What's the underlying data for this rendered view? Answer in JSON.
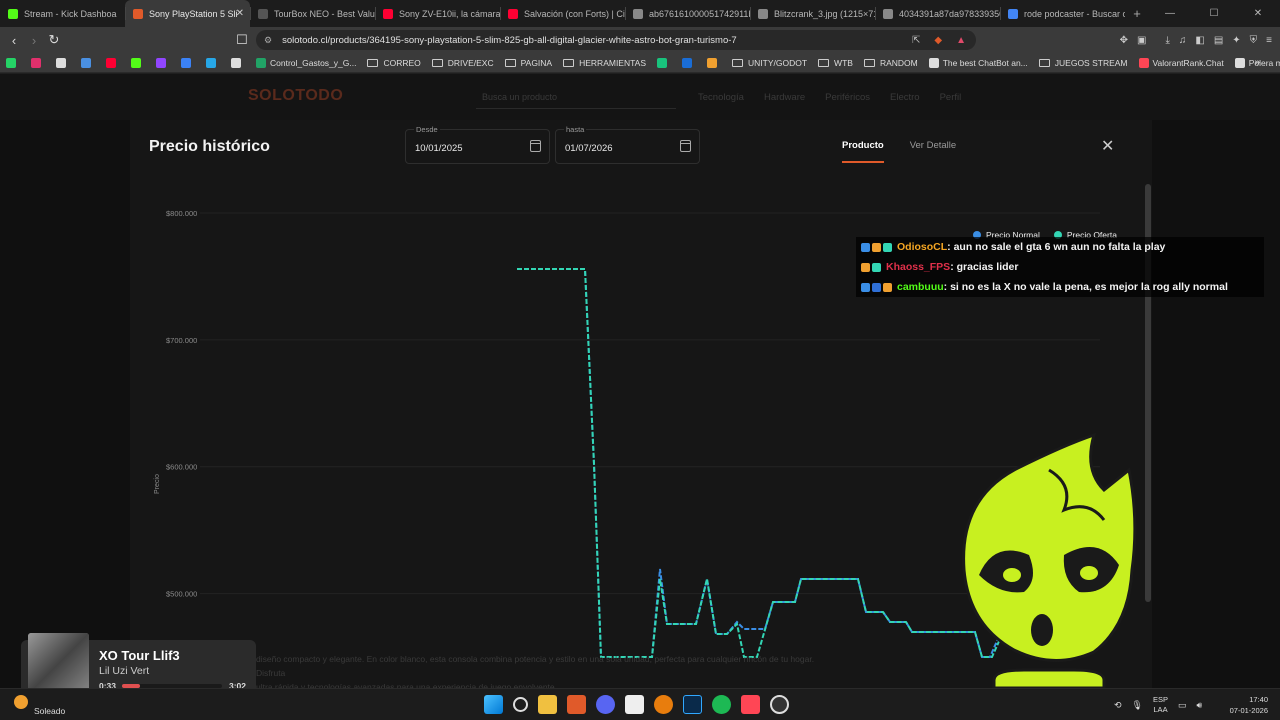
{
  "browser": {
    "tabs": [
      {
        "title": "Stream - Kick Dashboa",
        "color": "#53fc18"
      },
      {
        "title": "Sony PlayStation 5 Sli",
        "color": "#e05a2a",
        "active": true
      },
      {
        "title": "TourBox NEO - Best Value",
        "color": "#555555"
      },
      {
        "title": "Sony ZV-E10ii, la cámara o",
        "color": "#ff0033"
      },
      {
        "title": "Salvación (con Forts) | Cine",
        "color": "#ff0033"
      },
      {
        "title": "ab676161000051742911b",
        "color": "#888888"
      },
      {
        "title": "Blitzcrank_3.jpg (1215×71",
        "color": "#888888"
      },
      {
        "title": "4034391a87da978339350",
        "color": "#888888"
      },
      {
        "title": "rode podcaster - Buscar c",
        "color": "#4285f4"
      }
    ],
    "url": "solotodo.cl/products/364195-sony-playstation-5-slim-825-gb-all-digital-glacier-white-astro-bot-gran-turismo-7",
    "bookmarks": [
      {
        "label": "",
        "kind": "icon",
        "color": "#25d366"
      },
      {
        "label": "",
        "kind": "icon",
        "color": "#e1306c"
      },
      {
        "label": "",
        "kind": "icon",
        "color": "#dddddd"
      },
      {
        "label": "",
        "kind": "icon",
        "color": "#4a90e2"
      },
      {
        "label": "",
        "kind": "icon",
        "color": "#ff0033"
      },
      {
        "label": "",
        "kind": "icon",
        "color": "#53fc18"
      },
      {
        "label": "",
        "kind": "icon",
        "color": "#9146ff"
      },
      {
        "label": "",
        "kind": "icon",
        "color": "#3b82f6"
      },
      {
        "label": "",
        "kind": "icon",
        "color": "#27a7e7"
      },
      {
        "label": "",
        "kind": "icon",
        "color": "#dddddd"
      },
      {
        "label": "Control_Gastos_y_G...",
        "kind": "icon",
        "color": "#21a366"
      },
      {
        "label": "CORREO",
        "kind": "folder"
      },
      {
        "label": "DRIVE/EXC",
        "kind": "folder"
      },
      {
        "label": "PAGINA",
        "kind": "folder"
      },
      {
        "label": "HERRAMIENTAS",
        "kind": "folder"
      },
      {
        "label": "",
        "kind": "icon",
        "color": "#19c37d"
      },
      {
        "label": "",
        "kind": "icon",
        "color": "#1a6dd6"
      },
      {
        "label": "",
        "kind": "icon",
        "color": "#f0a030"
      },
      {
        "label": "UNITY/GODOT",
        "kind": "folder"
      },
      {
        "label": "WTB",
        "kind": "folder"
      },
      {
        "label": "RANDOM",
        "kind": "folder"
      },
      {
        "label": "The best ChatBot an...",
        "kind": "icon",
        "color": "#dddddd"
      },
      {
        "label": "JUEGOS STREAM",
        "kind": "folder"
      },
      {
        "label": "ValorantRank.Chat",
        "kind": "icon",
        "color": "#ff4655"
      },
      {
        "label": "Polera manga corta...",
        "kind": "icon",
        "color": "#dddddd"
      }
    ]
  },
  "site": {
    "logo": "SOLOTODO",
    "search_placeholder": "Busca un producto",
    "nav": [
      "Tecnología",
      "Hardware",
      "Periféricos",
      "Electro",
      "Perfil"
    ]
  },
  "modal": {
    "title": "Precio histórico",
    "from_label": "Desde",
    "from_value": "10/01/2025",
    "to_label": "hasta",
    "to_value": "01/07/2026",
    "tabs": [
      "Producto",
      "Ver Detalle"
    ],
    "legend": [
      {
        "name": "Precio Normal",
        "color": "#3a8ee6"
      },
      {
        "name": "Precio Oferta",
        "color": "#33d6b4"
      }
    ],
    "description_line1": "diseño compacto y elegante. En color blanco, esta consola combina potencia y estilo en una sola unidad, perfecta para cualquier rincón de tu hogar. Disfruta",
    "description_line2": "ultra rápida y tecnologías avanzadas para una experiencia de juego envolvente."
  },
  "chart_data": {
    "type": "line",
    "ylabel": "Precio",
    "yticks": [
      "$500.000",
      "$600.000",
      "$700.000",
      "$800.000"
    ],
    "ylim": [
      450000,
      800000
    ],
    "grid": true,
    "legend_position": "top-right",
    "series": [
      {
        "name": "Precio Normal",
        "color": "#3a8ee6",
        "dashed": true,
        "values": [
          750000,
          750000,
          750000,
          750000,
          750000,
          750000,
          750000,
          750000,
          600000,
          450000,
          450000,
          450000,
          450000,
          450000,
          450000,
          450000,
          450000,
          450000,
          450000,
          450000,
          450000,
          450000,
          450000,
          450000,
          450000,
          450000,
          450000,
          450000,
          450000,
          450000,
          450000,
          450000,
          450000,
          450000,
          450000,
          450000,
          450000,
          450000,
          450000,
          450000,
          450000,
          450000,
          450000,
          450000,
          450000,
          450000,
          450000,
          450000,
          450000,
          450000,
          450000,
          450000,
          450000,
          450000,
          450000,
          450000,
          450000,
          450000,
          450000,
          450000,
          450000,
          450000,
          450000,
          450000,
          450000,
          450000,
          450000,
          450000,
          450000,
          450000,
          450000,
          450000,
          450000,
          450000,
          450000,
          450000,
          450000,
          450000,
          450000,
          450000,
          450000,
          450000,
          450000,
          450000,
          450000,
          450000,
          450000,
          450000,
          450000,
          450000,
          450000,
          450000,
          450000,
          450000,
          450000,
          450000,
          450000,
          450000,
          450000,
          450000,
          450000,
          450000,
          450000,
          450000,
          450000,
          450000,
          450000,
          450000,
          450000,
          450000,
          450000,
          450000,
          450000,
          450000,
          450000,
          450000,
          450000,
          450000,
          450000,
          450000,
          450000,
          450000,
          450000,
          450000,
          450000,
          450000,
          450000,
          450000,
          450000,
          450000,
          450000,
          450000,
          450000,
          450000,
          450000,
          450000,
          450000,
          450000,
          450000,
          450000,
          450000,
          450000,
          450000,
          450000,
          450000,
          450000,
          450000,
          450000,
          450000,
          450000,
          450000,
          450000,
          450000,
          450000,
          450000,
          450000,
          450000,
          450000,
          450000,
          450000,
          450000,
          450000,
          450000,
          450000,
          450000,
          450000,
          450000,
          450000,
          450000,
          450000,
          450000,
          450000,
          450000,
          450000,
          450000,
          450000
        ]
      },
      {
        "name": "Precio Oferta",
        "color": "#33d6b4",
        "dashed": true,
        "values": [
          750000,
          750000,
          750000,
          750000,
          750000,
          750000,
          750000,
          750000,
          600000,
          450000
        ]
      }
    ]
  },
  "chat": [
    {
      "user": "OdiosoCL",
      "user_color": "#f5a623",
      "badges": [
        "#3a8ee6",
        "#f0a030",
        "#33d6b4"
      ],
      "message": ": aun no sale el gta 6 wn aun no falta la play"
    },
    {
      "user": "Khaoss_FPS",
      "user_color": "#e0304a",
      "badges": [
        "#f0a030",
        "#33d6b4"
      ],
      "message": ": gracias lider"
    },
    {
      "user": "cambuuu",
      "user_color": "#53fc18",
      "badges": [
        "#3a8ee6",
        "#2f6fd6",
        "#f0a030"
      ],
      "message": ": si no es la X no vale la pena, es mejor la rog ally normal"
    }
  ],
  "media": {
    "song": "XO Tour Llif3",
    "artist": "Lil Uzi Vert",
    "current": "0:33",
    "total": "3:02",
    "progress": 0.18
  },
  "taskbar": {
    "weather_text": "Soleado",
    "lang_line1": "ESP",
    "lang_line2": "LAA",
    "time": "17:40",
    "date": "07-01-2026"
  }
}
